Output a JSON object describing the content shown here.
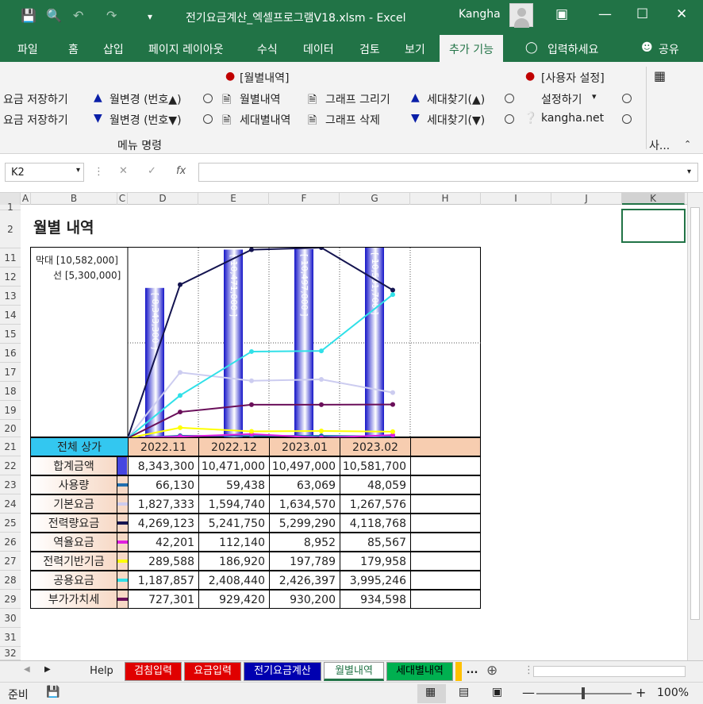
{
  "window": {
    "title": "전기요금계산_엑셀프로그램V18.xlsm  -  Excel",
    "user": "Kangha"
  },
  "tabs": [
    "파일",
    "홈",
    "삽입",
    "페이지 레이아웃",
    "수식",
    "데이터",
    "검토",
    "보기",
    "추가 기능",
    "입력하세요",
    "공유"
  ],
  "ribbon": {
    "save1": "요금 저장하기",
    "save2": "요금 저장하기",
    "month_up": "월변경 (번호▲)",
    "month_down": "월변경 (번호▼)",
    "monthly_header": "[월별내역]",
    "monthly": "월별내역",
    "household": "세대별내역",
    "graph_draw": "그래프 그리기",
    "graph_delete": "그래프 삭제",
    "find_up": "세대찾기(▲)",
    "find_down": "세대찾기(▼)",
    "user_header": "[사용자 설정]",
    "settings": "설정하기",
    "site": "kangha.net",
    "group_label": "메뉴 명령",
    "group2": "사..."
  },
  "namebox": "K2",
  "columns": [
    "A",
    "B",
    "C",
    "D",
    "E",
    "F",
    "G",
    "H",
    "I",
    "J",
    "K"
  ],
  "rows": [
    "1",
    "2",
    "11",
    "12",
    "13",
    "14",
    "15",
    "16",
    "17",
    "18",
    "19",
    "20",
    "21",
    "22",
    "23",
    "24",
    "25",
    "26",
    "27",
    "28",
    "29",
    "30",
    "31",
    "32"
  ],
  "sheet_title": "월별 내역",
  "legend": {
    "bar": "막대  [10,582,000]",
    "line": "선  [5,300,000]"
  },
  "table": {
    "corner": "전체 상가",
    "months": [
      "2022.11",
      "2022.12",
      "2023.01",
      "2023.02"
    ],
    "rows": [
      {
        "label": "합계금액",
        "vals": [
          "8,343,300",
          "10,471,000",
          "10,497,000",
          "10,581,700"
        ],
        "color": "#4545e0"
      },
      {
        "label": "사용량",
        "vals": [
          "66,130",
          "59,438",
          "63,069",
          "48,059"
        ],
        "color": "#1f6fb0"
      },
      {
        "label": "기본요금",
        "vals": [
          "1,827,333",
          "1,594,740",
          "1,634,570",
          "1,267,576"
        ],
        "color": "#ccccf0"
      },
      {
        "label": "전력량요금",
        "vals": [
          "4,269,123",
          "5,241,750",
          "5,299,290",
          "4,118,768"
        ],
        "color": "#141450"
      },
      {
        "label": "역율요금",
        "vals": [
          "42,201",
          "112,140",
          "8,952",
          "85,567"
        ],
        "color": "#e020e0"
      },
      {
        "label": "전력기반기금",
        "vals": [
          "289,588",
          "186,920",
          "197,789",
          "179,958"
        ],
        "color": "#ffff00"
      },
      {
        "label": "공용요금",
        "vals": [
          "1,187,857",
          "2,408,440",
          "2,426,397",
          "3,995,246"
        ],
        "color": "#30e0e8"
      },
      {
        "label": "부가가치세",
        "vals": [
          "727,301",
          "929,420",
          "930,200",
          "934,598"
        ],
        "color": "#6a0f5a"
      }
    ]
  },
  "chart_data": {
    "type": "bar",
    "categories": [
      "2022.11",
      "2022.12",
      "2023.01",
      "2023.02"
    ],
    "bar_labels": [
      "[ 8,343,300 ]",
      "[ 10,471,000 ]",
      "[ 10,497,000 ]",
      "[ 10,581,700 ]"
    ],
    "bar_values": [
      8343300,
      10471000,
      10497000,
      10581700
    ],
    "bar_max": 10582000,
    "line_max": 5300000,
    "series": [
      {
        "name": "사용량",
        "color": "#1f6fb0",
        "values": [
          66130,
          59438,
          63069,
          48059
        ]
      },
      {
        "name": "기본요금",
        "color": "#ccccf0",
        "values": [
          1827333,
          1594740,
          1634570,
          1267576
        ]
      },
      {
        "name": "전력량요금",
        "color": "#141450",
        "values": [
          4269123,
          5241750,
          5299290,
          4118768
        ]
      },
      {
        "name": "역율요금",
        "color": "#e020e0",
        "values": [
          42201,
          112140,
          8952,
          85567
        ]
      },
      {
        "name": "전력기반기금",
        "color": "#ffff00",
        "values": [
          289588,
          186920,
          197789,
          179958
        ]
      },
      {
        "name": "공용요금",
        "color": "#30e0e8",
        "values": [
          1187857,
          2408440,
          2426397,
          3995246
        ]
      },
      {
        "name": "부가가치세",
        "color": "#6a0f5a",
        "values": [
          727301,
          929420,
          930200,
          934598
        ]
      }
    ]
  },
  "sheets": [
    "Help",
    "검침입력",
    "요금입력",
    "전기요금계산",
    "월별내역",
    "세대별내역",
    "..."
  ],
  "status": {
    "ready": "준비",
    "zoom": "100%"
  }
}
